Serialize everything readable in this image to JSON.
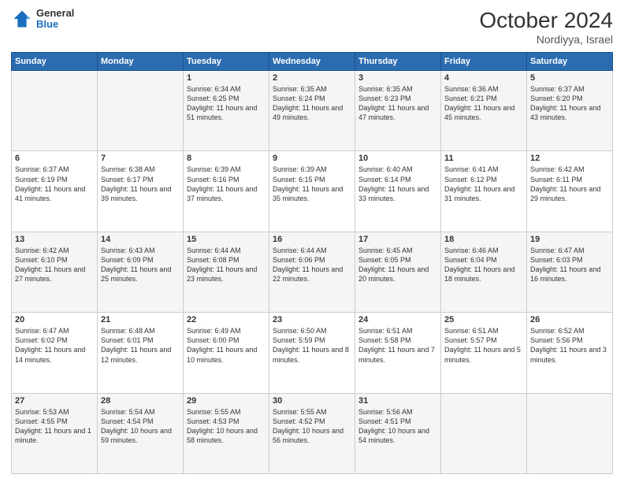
{
  "header": {
    "logo_general": "General",
    "logo_blue": "Blue",
    "month_title": "October 2024",
    "location": "Nordiyya, Israel"
  },
  "days_of_week": [
    "Sunday",
    "Monday",
    "Tuesday",
    "Wednesday",
    "Thursday",
    "Friday",
    "Saturday"
  ],
  "weeks": [
    [
      {
        "day": "",
        "sunrise": "",
        "sunset": "",
        "daylight": ""
      },
      {
        "day": "",
        "sunrise": "",
        "sunset": "",
        "daylight": ""
      },
      {
        "day": "1",
        "sunrise": "Sunrise: 6:34 AM",
        "sunset": "Sunset: 6:25 PM",
        "daylight": "Daylight: 11 hours and 51 minutes."
      },
      {
        "day": "2",
        "sunrise": "Sunrise: 6:35 AM",
        "sunset": "Sunset: 6:24 PM",
        "daylight": "Daylight: 11 hours and 49 minutes."
      },
      {
        "day": "3",
        "sunrise": "Sunrise: 6:35 AM",
        "sunset": "Sunset: 6:23 PM",
        "daylight": "Daylight: 11 hours and 47 minutes."
      },
      {
        "day": "4",
        "sunrise": "Sunrise: 6:36 AM",
        "sunset": "Sunset: 6:21 PM",
        "daylight": "Daylight: 11 hours and 45 minutes."
      },
      {
        "day": "5",
        "sunrise": "Sunrise: 6:37 AM",
        "sunset": "Sunset: 6:20 PM",
        "daylight": "Daylight: 11 hours and 43 minutes."
      }
    ],
    [
      {
        "day": "6",
        "sunrise": "Sunrise: 6:37 AM",
        "sunset": "Sunset: 6:19 PM",
        "daylight": "Daylight: 11 hours and 41 minutes."
      },
      {
        "day": "7",
        "sunrise": "Sunrise: 6:38 AM",
        "sunset": "Sunset: 6:17 PM",
        "daylight": "Daylight: 11 hours and 39 minutes."
      },
      {
        "day": "8",
        "sunrise": "Sunrise: 6:39 AM",
        "sunset": "Sunset: 6:16 PM",
        "daylight": "Daylight: 11 hours and 37 minutes."
      },
      {
        "day": "9",
        "sunrise": "Sunrise: 6:39 AM",
        "sunset": "Sunset: 6:15 PM",
        "daylight": "Daylight: 11 hours and 35 minutes."
      },
      {
        "day": "10",
        "sunrise": "Sunrise: 6:40 AM",
        "sunset": "Sunset: 6:14 PM",
        "daylight": "Daylight: 11 hours and 33 minutes."
      },
      {
        "day": "11",
        "sunrise": "Sunrise: 6:41 AM",
        "sunset": "Sunset: 6:12 PM",
        "daylight": "Daylight: 11 hours and 31 minutes."
      },
      {
        "day": "12",
        "sunrise": "Sunrise: 6:42 AM",
        "sunset": "Sunset: 6:11 PM",
        "daylight": "Daylight: 11 hours and 29 minutes."
      }
    ],
    [
      {
        "day": "13",
        "sunrise": "Sunrise: 6:42 AM",
        "sunset": "Sunset: 6:10 PM",
        "daylight": "Daylight: 11 hours and 27 minutes."
      },
      {
        "day": "14",
        "sunrise": "Sunrise: 6:43 AM",
        "sunset": "Sunset: 6:09 PM",
        "daylight": "Daylight: 11 hours and 25 minutes."
      },
      {
        "day": "15",
        "sunrise": "Sunrise: 6:44 AM",
        "sunset": "Sunset: 6:08 PM",
        "daylight": "Daylight: 11 hours and 23 minutes."
      },
      {
        "day": "16",
        "sunrise": "Sunrise: 6:44 AM",
        "sunset": "Sunset: 6:06 PM",
        "daylight": "Daylight: 11 hours and 22 minutes."
      },
      {
        "day": "17",
        "sunrise": "Sunrise: 6:45 AM",
        "sunset": "Sunset: 6:05 PM",
        "daylight": "Daylight: 11 hours and 20 minutes."
      },
      {
        "day": "18",
        "sunrise": "Sunrise: 6:46 AM",
        "sunset": "Sunset: 6:04 PM",
        "daylight": "Daylight: 11 hours and 18 minutes."
      },
      {
        "day": "19",
        "sunrise": "Sunrise: 6:47 AM",
        "sunset": "Sunset: 6:03 PM",
        "daylight": "Daylight: 11 hours and 16 minutes."
      }
    ],
    [
      {
        "day": "20",
        "sunrise": "Sunrise: 6:47 AM",
        "sunset": "Sunset: 6:02 PM",
        "daylight": "Daylight: 11 hours and 14 minutes."
      },
      {
        "day": "21",
        "sunrise": "Sunrise: 6:48 AM",
        "sunset": "Sunset: 6:01 PM",
        "daylight": "Daylight: 11 hours and 12 minutes."
      },
      {
        "day": "22",
        "sunrise": "Sunrise: 6:49 AM",
        "sunset": "Sunset: 6:00 PM",
        "daylight": "Daylight: 11 hours and 10 minutes."
      },
      {
        "day": "23",
        "sunrise": "Sunrise: 6:50 AM",
        "sunset": "Sunset: 5:59 PM",
        "daylight": "Daylight: 11 hours and 8 minutes."
      },
      {
        "day": "24",
        "sunrise": "Sunrise: 6:51 AM",
        "sunset": "Sunset: 5:58 PM",
        "daylight": "Daylight: 11 hours and 7 minutes."
      },
      {
        "day": "25",
        "sunrise": "Sunrise: 6:51 AM",
        "sunset": "Sunset: 5:57 PM",
        "daylight": "Daylight: 11 hours and 5 minutes."
      },
      {
        "day": "26",
        "sunrise": "Sunrise: 6:52 AM",
        "sunset": "Sunset: 5:56 PM",
        "daylight": "Daylight: 11 hours and 3 minutes."
      }
    ],
    [
      {
        "day": "27",
        "sunrise": "Sunrise: 5:53 AM",
        "sunset": "Sunset: 4:55 PM",
        "daylight": "Daylight: 11 hours and 1 minute."
      },
      {
        "day": "28",
        "sunrise": "Sunrise: 5:54 AM",
        "sunset": "Sunset: 4:54 PM",
        "daylight": "Daylight: 10 hours and 59 minutes."
      },
      {
        "day": "29",
        "sunrise": "Sunrise: 5:55 AM",
        "sunset": "Sunset: 4:53 PM",
        "daylight": "Daylight: 10 hours and 58 minutes."
      },
      {
        "day": "30",
        "sunrise": "Sunrise: 5:55 AM",
        "sunset": "Sunset: 4:52 PM",
        "daylight": "Daylight: 10 hours and 56 minutes."
      },
      {
        "day": "31",
        "sunrise": "Sunrise: 5:56 AM",
        "sunset": "Sunset: 4:51 PM",
        "daylight": "Daylight: 10 hours and 54 minutes."
      },
      {
        "day": "",
        "sunrise": "",
        "sunset": "",
        "daylight": ""
      },
      {
        "day": "",
        "sunrise": "",
        "sunset": "",
        "daylight": ""
      }
    ]
  ]
}
